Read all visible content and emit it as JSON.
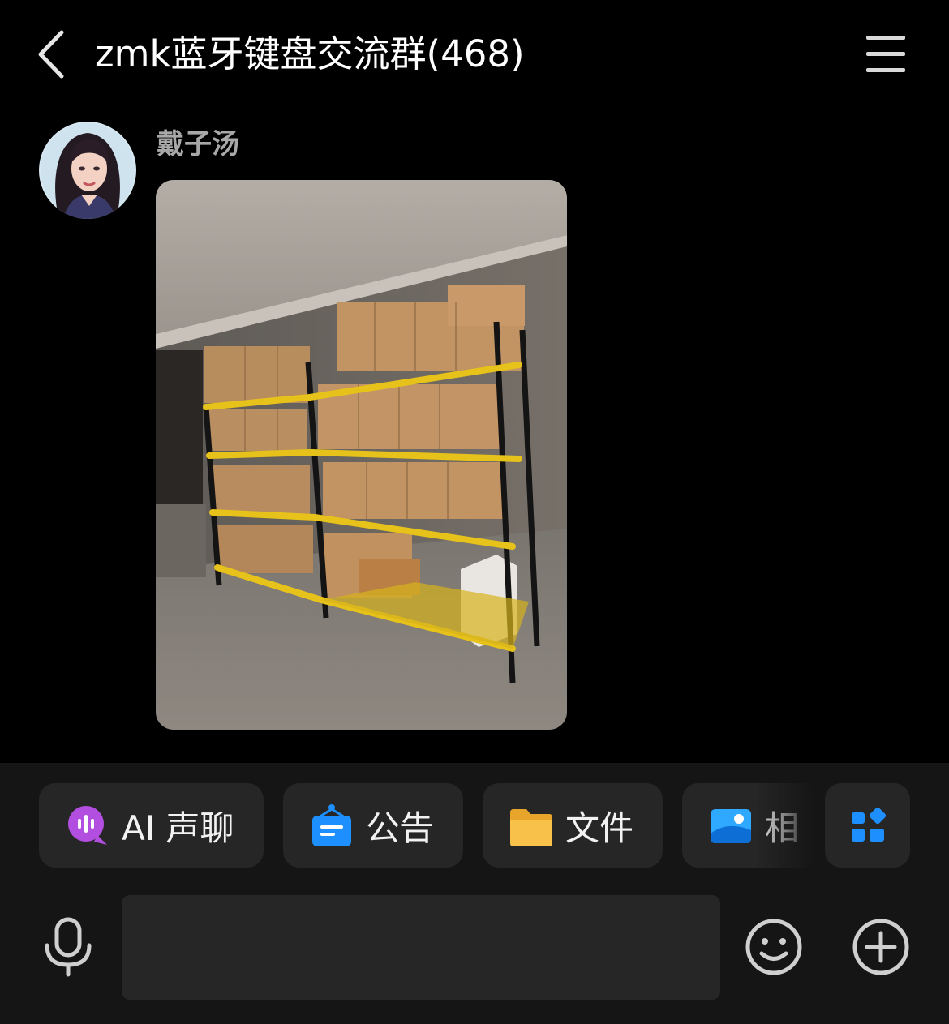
{
  "header": {
    "title": "zmk蓝牙键盘交流群(468)",
    "back_icon": "chevron-left-icon",
    "menu_icon": "hamburger-menu-icon"
  },
  "message": {
    "sender": "戴子汤",
    "avatar": "avatar-illustrated-girl",
    "content_type": "image",
    "image_subject": "yellow storage shelves with cardboard boxes"
  },
  "quick_actions": [
    {
      "label": "AI 声聊",
      "icon": "ai-voice-chat-icon",
      "color": "#b34fe0"
    },
    {
      "label": "公告",
      "icon": "announcement-icon",
      "color": "#1e8fff"
    },
    {
      "label": "文件",
      "icon": "folder-icon",
      "color": "#f5b93d"
    },
    {
      "label": "相",
      "icon": "album-icon",
      "color": "#2fa8ff"
    }
  ],
  "more_apps_icon": "apps-grid-icon",
  "input": {
    "value": "",
    "placeholder": ""
  },
  "colors": {
    "background": "#000000",
    "panel": "#151515",
    "chip": "#262626",
    "accent_blue": "#1e8fff"
  }
}
